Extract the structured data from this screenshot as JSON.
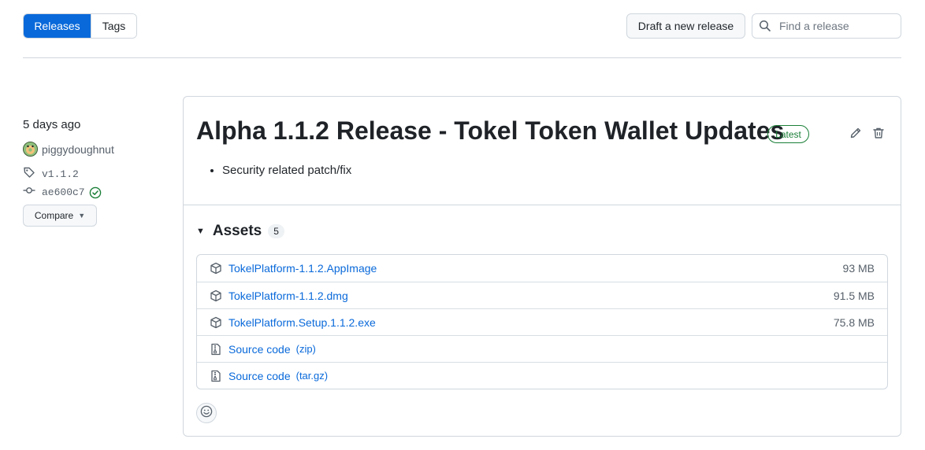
{
  "tabs": {
    "releases": "Releases",
    "tags": "Tags"
  },
  "toolbar": {
    "draft_label": "Draft a new release",
    "search_placeholder": "Find a release"
  },
  "sidebar": {
    "time_ago": "5 days ago",
    "author": "piggydoughnut",
    "tag": "v1.1.2",
    "commit": "ae600c7",
    "compare_label": "Compare"
  },
  "release": {
    "title": "Alpha 1.1.2 Release - Tokel Token Wallet Updates",
    "badge": "Latest",
    "notes": [
      "Security related patch/fix"
    ]
  },
  "assets": {
    "title": "Assets",
    "count": "5",
    "items": [
      {
        "name": "TokelPlatform-1.1.2.AppImage",
        "suffix": "",
        "size": "93 MB",
        "icon": "package-icon"
      },
      {
        "name": "TokelPlatform-1.1.2.dmg",
        "suffix": "",
        "size": "91.5 MB",
        "icon": "package-icon"
      },
      {
        "name": "TokelPlatform.Setup.1.1.2.exe",
        "suffix": "",
        "size": "75.8 MB",
        "icon": "package-icon"
      },
      {
        "name": "Source code",
        "suffix": "(zip)",
        "size": "",
        "icon": "file-zip-icon"
      },
      {
        "name": "Source code",
        "suffix": "(tar.gz)",
        "size": "",
        "icon": "file-zip-icon"
      }
    ]
  },
  "colors": {
    "accent": "#0969da",
    "success": "#1a7f37",
    "border": "#d0d7de",
    "muted": "#57606a"
  }
}
